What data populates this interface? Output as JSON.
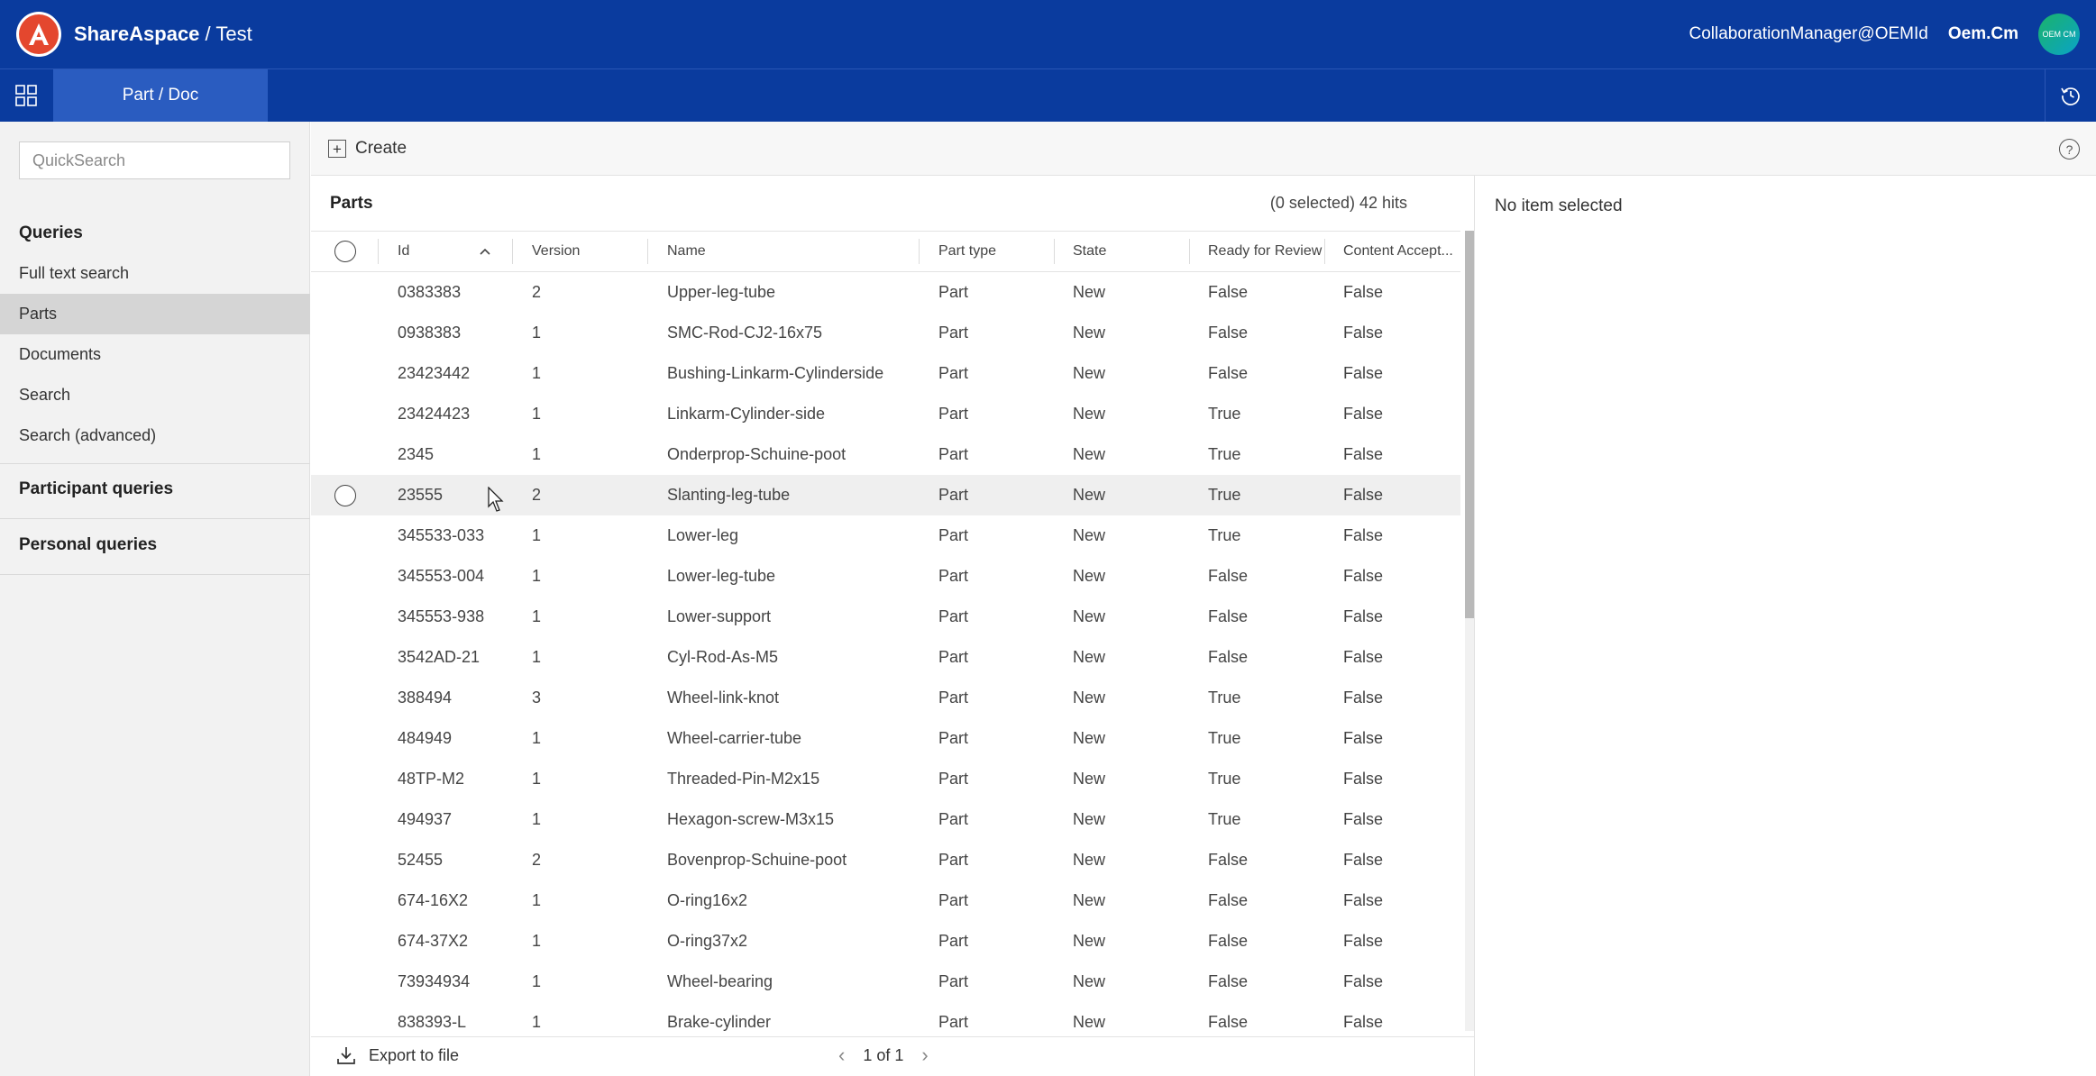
{
  "app": {
    "brand": "ShareAspace",
    "workspace": "/ Test",
    "user_email": "CollaborationManager@OEMId",
    "user_org": "Oem.Cm",
    "avatar_text": "OEM CM"
  },
  "nav": {
    "active_tab": "Part / Doc"
  },
  "sidebar": {
    "quicksearch_placeholder": "QuickSearch",
    "queries_heading": "Queries",
    "items": [
      {
        "label": "Full text search"
      },
      {
        "label": "Parts"
      },
      {
        "label": "Documents"
      },
      {
        "label": "Search"
      },
      {
        "label": "Search (advanced)"
      }
    ],
    "active_item": "Parts",
    "participant_heading": "Participant queries",
    "personal_heading": "Personal queries"
  },
  "toolbar": {
    "create_label": "Create",
    "help_label": "?"
  },
  "list": {
    "title": "Parts",
    "hits": "(0 selected) 42 hits",
    "columns": [
      "Id",
      "Version",
      "Name",
      "Part type",
      "State",
      "Ready for Review",
      "Content Accept..."
    ],
    "sorted_column": "Id",
    "rows": [
      [
        "0383383",
        "2",
        "Upper-leg-tube",
        "Part",
        "New",
        "False",
        "False"
      ],
      [
        "0938383",
        "1",
        "SMC-Rod-CJ2-16x75",
        "Part",
        "New",
        "False",
        "False"
      ],
      [
        "23423442",
        "1",
        "Bushing-Linkarm-Cylinderside",
        "Part",
        "New",
        "False",
        "False"
      ],
      [
        "23424423",
        "1",
        "Linkarm-Cylinder-side",
        "Part",
        "New",
        "True",
        "False"
      ],
      [
        "2345",
        "1",
        "Onderprop-Schuine-poot",
        "Part",
        "New",
        "True",
        "False"
      ],
      [
        "23555",
        "2",
        "Slanting-leg-tube",
        "Part",
        "New",
        "True",
        "False"
      ],
      [
        "345533-033",
        "1",
        "Lower-leg",
        "Part",
        "New",
        "True",
        "False"
      ],
      [
        "345553-004",
        "1",
        "Lower-leg-tube",
        "Part",
        "New",
        "False",
        "False"
      ],
      [
        "345553-938",
        "1",
        "Lower-support",
        "Part",
        "New",
        "False",
        "False"
      ],
      [
        "3542AD-21",
        "1",
        "Cyl-Rod-As-M5",
        "Part",
        "New",
        "False",
        "False"
      ],
      [
        "388494",
        "3",
        "Wheel-link-knot",
        "Part",
        "New",
        "True",
        "False"
      ],
      [
        "484949",
        "1",
        "Wheel-carrier-tube",
        "Part",
        "New",
        "True",
        "False"
      ],
      [
        "48TP-M2",
        "1",
        "Threaded-Pin-M2x15",
        "Part",
        "New",
        "True",
        "False"
      ],
      [
        "494937",
        "1",
        "Hexagon-screw-M3x15",
        "Part",
        "New",
        "True",
        "False"
      ],
      [
        "52455",
        "2",
        "Bovenprop-Schuine-poot",
        "Part",
        "New",
        "False",
        "False"
      ],
      [
        "674-16X2",
        "1",
        "O-ring16x2",
        "Part",
        "New",
        "False",
        "False"
      ],
      [
        "674-37X2",
        "1",
        "O-ring37x2",
        "Part",
        "New",
        "False",
        "False"
      ],
      [
        "73934934",
        "1",
        "Wheel-bearing",
        "Part",
        "New",
        "False",
        "False"
      ],
      [
        "838393-L",
        "1",
        "Brake-cylinder",
        "Part",
        "New",
        "False",
        "False"
      ]
    ],
    "hovered_row_id": "23555"
  },
  "footer": {
    "export_label": "Export to file",
    "page_label": "1 of 1"
  },
  "detail": {
    "empty_text": "No item selected"
  },
  "colors": {
    "header_bg": "#0a3b9e",
    "active_tab_bg": "#2a5cc0",
    "logo_red": "#e4472e"
  }
}
